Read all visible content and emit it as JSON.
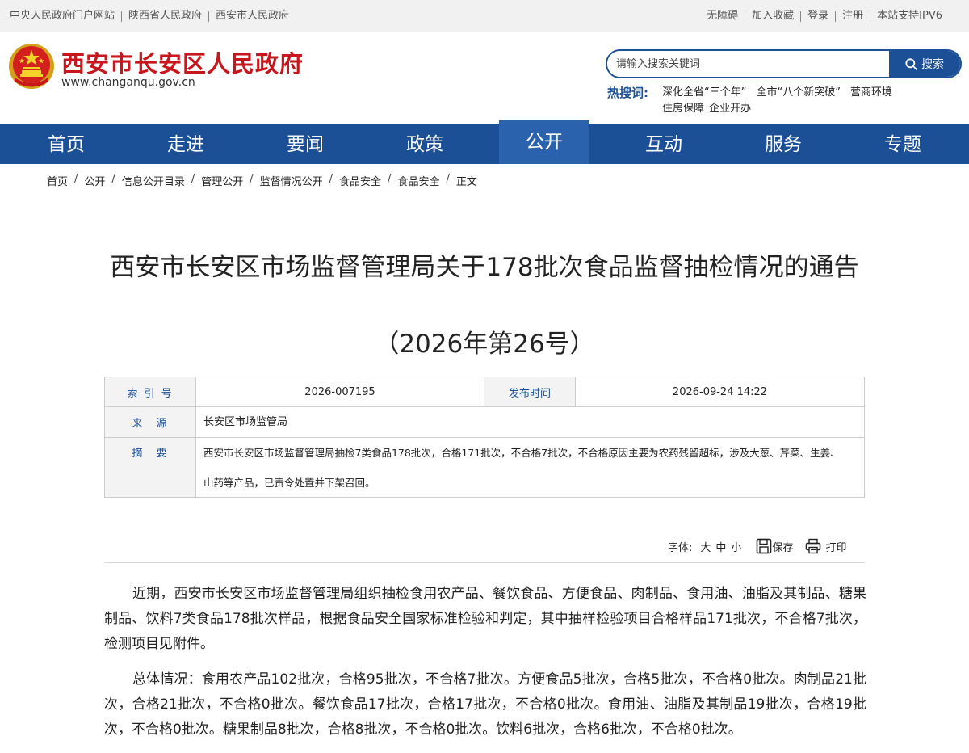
{
  "topbar": {
    "left_links": [
      "中央人民政府门户网站",
      "陕西省人民政府",
      "西安市人民政府"
    ],
    "right_links": [
      "无障碍",
      "加入收藏",
      "登录",
      "注册",
      "本站支持IPV6"
    ]
  },
  "header": {
    "site_title": "西安市长安区人民政府",
    "site_url": "www.changanqu.gov.cn",
    "emblem_icon": "national-emblem-icon",
    "search": {
      "placeholder": "请输入搜索关键词",
      "button_label": "搜索"
    },
    "hot_search": {
      "label": "热搜词:",
      "items": [
        "深化全省“三个年”",
        "全市“八个新突破”",
        "营商环境",
        "住房保障",
        "企业开办"
      ]
    }
  },
  "nav": {
    "items": [
      "首页",
      "走进",
      "要闻",
      "政策",
      "公开",
      "互动",
      "服务",
      "专题"
    ],
    "active": "公开"
  },
  "breadcrumb": [
    "首页",
    "公开",
    "信息公开目录",
    "管理公开",
    "监督情况公开",
    "食品安全",
    "食品安全",
    "正文"
  ],
  "article": {
    "title": "西安市长安区市场监督管理局关于178批次食品监督抽检情况的通告",
    "subtitle": "（2026年第26号）",
    "meta": {
      "index_label": "索 引 号",
      "index_value": "2026-007195",
      "date_label": "发布时间",
      "date_value": "2026-09-24 14:22",
      "source_label": "来　源",
      "source_value": "长安区市场监管局",
      "summary_label": "摘　要",
      "summary_value": "西安市长安区市场监督管理局抽检7类食品178批次，合格171批次，不合格7批次，不合格原因主要为农药残留超标，涉及大葱、芹菜、生姜、山药等产品，已责令处置并下架召回。"
    },
    "tools": {
      "font_label": "字体:",
      "sizes": [
        "大",
        "中",
        "小"
      ],
      "save_label": "保存",
      "print_label": "打印"
    },
    "paragraphs": [
      "近期，西安市长安区市场监督管理局组织抽检食用农产品、餐饮食品、方便食品、肉制品、食用油、油脂及其制品、糖果制品、饮料7类食品178批次样品，根据食品安全国家标准检验和判定，其中抽样检验项目合格样品171批次，不合格7批次，检测项目见附件。",
      "总体情况：食用农产品102批次，合格95批次，不合格7批次。方便食品5批次，合格5批次，不合格0批次。肉制品21批次，合格21批次，不合格0批次。餐饮食品17批次，合格17批次，不合格0批次。食用油、油脂及其制品19批次，合格19批次，不合格0批次。糖果制品8批次，合格8批次，不合格0批次。饮料6批次，合格6批次，不合格0批次。"
    ]
  },
  "colors": {
    "brand_blue": "#1b4f96",
    "active_nav": "#2a62ad",
    "title_red": "#c8161d"
  }
}
